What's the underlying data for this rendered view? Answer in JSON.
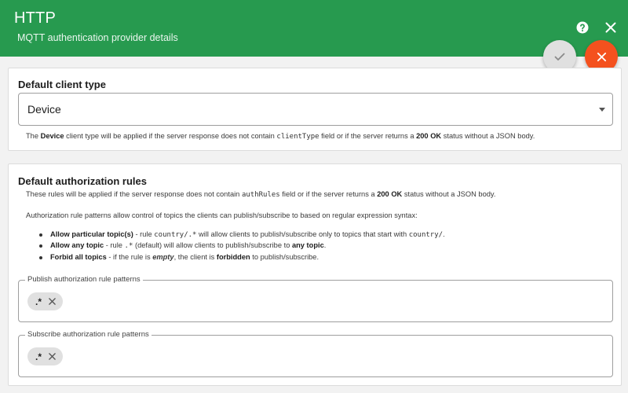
{
  "header": {
    "title": "HTTP",
    "subtitle": "MQTT authentication provider details",
    "icons": {
      "help": "help-icon",
      "close": "close-icon"
    },
    "background_color": "#279a4f"
  },
  "actions": {
    "save_icon": "check-icon",
    "cancel_icon": "close-icon",
    "cancel_color": "#f4511e"
  },
  "client_type": {
    "title": "Default client type",
    "selected_value": "Device",
    "hint": {
      "prefix": "The ",
      "bold_type": "Device",
      "middle": " client type will be applied if the server response does not contain ",
      "code": "clientType",
      "middle2": " field or if the server returns a ",
      "bold_status": "200 OK",
      "suffix": " status without a JSON body."
    }
  },
  "auth_rules": {
    "title": "Default authorization rules",
    "hint1": {
      "prefix": "These rules will be applied if the server response does not contain ",
      "code": "authRules",
      "middle": " field or if the server returns a ",
      "bold_status": "200 OK",
      "suffix": " status without a JSON body."
    },
    "hint2": "Authorization rule patterns allow control of topics the clients can publish/subscribe to based on regular expression syntax:",
    "bullets": [
      {
        "bold": "Allow particular topic(s)",
        "t1": " - rule ",
        "code": "country/.*",
        "t2": " will allow clients to publish/subscribe only to topics that start with ",
        "code2": "country/",
        "t3": "."
      },
      {
        "bold": "Allow any topic",
        "t1": " - rule ",
        "code": ".*",
        "t2": " (default) will allow clients to publish/subscribe to ",
        "bold2": "any topic",
        "t3": "."
      },
      {
        "bold": "Forbid all topics",
        "t1": " - if the rule is ",
        "italic": "empty",
        "t2": ", the client is ",
        "bold2": "forbidden",
        "t3": " to publish/subscribe."
      }
    ],
    "publish": {
      "legend": "Publish authorization rule patterns",
      "chips": [
        ".*"
      ]
    },
    "subscribe": {
      "legend": "Subscribe authorization rule patterns",
      "chips": [
        ".*"
      ]
    }
  }
}
